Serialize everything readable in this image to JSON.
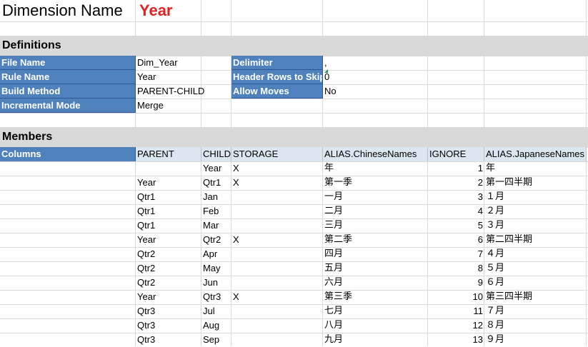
{
  "title": {
    "label": "Dimension Name",
    "value": "Year"
  },
  "definitions": {
    "section": "Definitions",
    "file_name_label": "File Name",
    "file_name": "Dim_Year",
    "rule_name_label": "Rule Name",
    "rule_name": "Year",
    "build_method_label": "Build Method",
    "build_method": "PARENT-CHILD",
    "incremental_mode_label": "Incremental Mode",
    "incremental_mode": "Merge",
    "delimiter_label": "Delimiter",
    "delimiter": ",",
    "header_rows_label": "Header Rows to Skip",
    "header_rows": "0",
    "allow_moves_label": "Allow Moves",
    "allow_moves": "No"
  },
  "members": {
    "section": "Members",
    "columns": [
      "Columns",
      "PARENT",
      "CHILD",
      "STORAGE",
      "ALIAS.ChineseNames",
      "IGNORE",
      "ALIAS.JapaneseNames"
    ],
    "rows": [
      [
        "",
        "",
        "Year",
        "X",
        "年",
        "1",
        "年"
      ],
      [
        "",
        "Year",
        "Qtr1",
        "X",
        "第一季",
        "2",
        "第一四半期"
      ],
      [
        "",
        "Qtr1",
        "Jan",
        "",
        "一月",
        "3",
        "１月"
      ],
      [
        "",
        "Qtr1",
        "Feb",
        "",
        "二月",
        "4",
        "２月"
      ],
      [
        "",
        "Qtr1",
        "Mar",
        "",
        "三月",
        "5",
        "３月"
      ],
      [
        "",
        "Year",
        "Qtr2",
        "X",
        "第二季",
        "6",
        "第二四半期"
      ],
      [
        "",
        "Qtr2",
        "Apr",
        "",
        "四月",
        "7",
        "４月"
      ],
      [
        "",
        "Qtr2",
        "May",
        "",
        "五月",
        "8",
        "５月"
      ],
      [
        "",
        "Qtr2",
        "Jun",
        "",
        "六月",
        "9",
        "６月"
      ],
      [
        "",
        "Year",
        "Qtr3",
        "X",
        "第三季",
        "10",
        "第三四半期"
      ],
      [
        "",
        "Qtr3",
        "Jul",
        "",
        "七月",
        "11",
        "７月"
      ],
      [
        "",
        "Qtr3",
        "Aug",
        "",
        "八月",
        "12",
        "８月"
      ],
      [
        "",
        "Qtr3",
        "Sep",
        "",
        "九月",
        "13",
        "９月"
      ]
    ]
  }
}
